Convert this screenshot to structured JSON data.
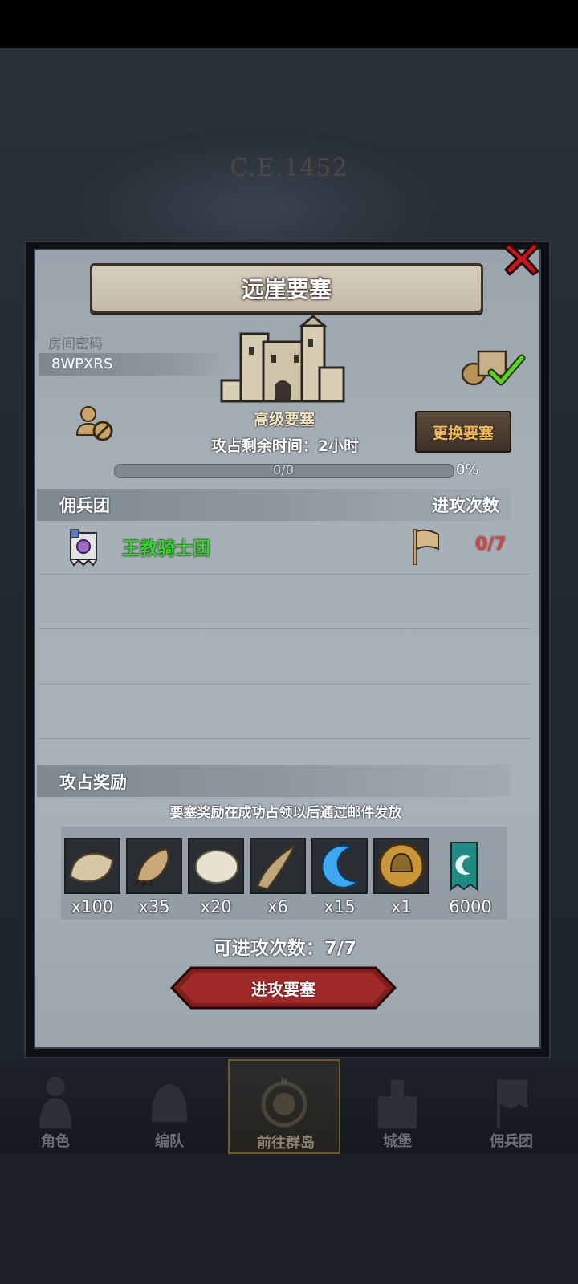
{
  "background": {
    "year_label": "C.E.1452"
  },
  "dialog": {
    "title": "远崖要塞",
    "room": {
      "label": "房间密码",
      "code": "8WPXRS"
    },
    "fortress_level": "高级要塞",
    "change_button": "更换要塞",
    "time_left": "攻占剩余时间：2小时",
    "progress": {
      "text": "0/0",
      "percent_label": "0%",
      "fraction": 0
    },
    "mercenary_section": {
      "title": "佣兵团",
      "attacks_header": "进攻次数",
      "rows": [
        {
          "name": "王教骑士团",
          "attacks": "0/7"
        }
      ]
    },
    "reward_section": {
      "title": "攻占奖励",
      "note": "要塞奖励在成功占领以后通过邮件发放",
      "items": [
        {
          "icon": "fur-pelt-icon",
          "count": "x100"
        },
        {
          "icon": "claw-icon",
          "count": "x35"
        },
        {
          "icon": "white-pelt-icon",
          "count": "x20"
        },
        {
          "icon": "horn-icon",
          "count": "x6"
        },
        {
          "icon": "blue-crescent-icon",
          "count": "x15"
        },
        {
          "icon": "helmet-medal-icon",
          "count": "x1"
        },
        {
          "icon": "guild-banner-icon",
          "count": "6000"
        }
      ]
    },
    "attempts": "可进攻次数：7/7",
    "attack_button": "进攻要塞"
  },
  "bottom_nav": [
    {
      "label": "角色",
      "icon": "knight-icon",
      "active": false
    },
    {
      "label": "编队",
      "icon": "helmet-icon",
      "active": false
    },
    {
      "label": "前往群岛",
      "icon": "compass-icon",
      "active": true
    },
    {
      "label": "城堡",
      "icon": "castle-icon",
      "active": false
    },
    {
      "label": "佣兵团",
      "icon": "banner-icon",
      "active": false
    }
  ],
  "colors": {
    "merc_name": "#3fcf38",
    "attack_count": "#d24646",
    "change_button_text": "#f2b95a",
    "attack_button": "#7a1e1e"
  }
}
